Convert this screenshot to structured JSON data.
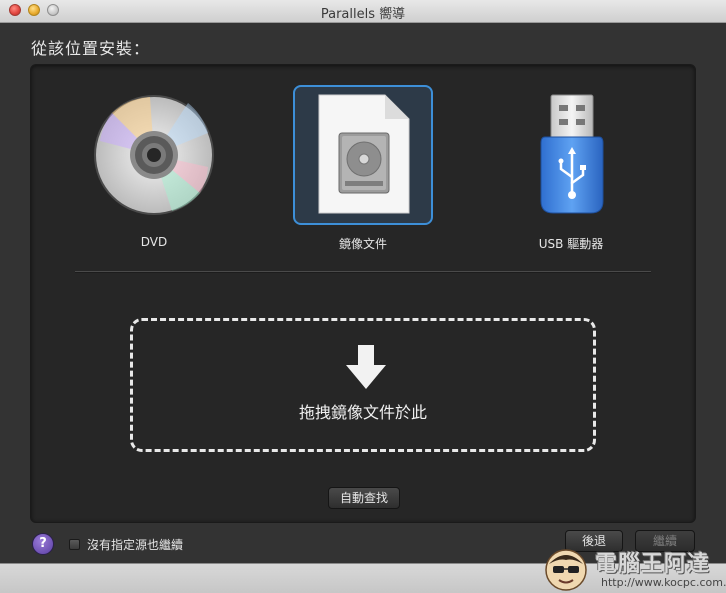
{
  "window": {
    "title": "Parallels 嚮導"
  },
  "heading": "從該位置安裝：",
  "sources": [
    {
      "label": "DVD",
      "icon": "dvd-disc-icon",
      "selected": false
    },
    {
      "label": "鏡像文件",
      "icon": "disk-image-file-icon",
      "selected": true
    },
    {
      "label": "USB 驅動器",
      "icon": "usb-drive-icon",
      "selected": false
    }
  ],
  "dropzone": {
    "text": "拖拽鏡像文件於此",
    "icon": "down-arrow-icon"
  },
  "buttons": {
    "auto_find": "自動查找",
    "back": "後退",
    "next": "繼續"
  },
  "help": {
    "icon": "help-icon",
    "glyph": "?"
  },
  "checkbox": {
    "label": "沒有指定源也繼續",
    "checked": false
  },
  "watermark": {
    "title": "電腦王阿達",
    "url": "http://www.kocpc.com.tw"
  },
  "colors": {
    "selection": "#3d8fd8",
    "panel": "#262626",
    "window": "#333333"
  }
}
